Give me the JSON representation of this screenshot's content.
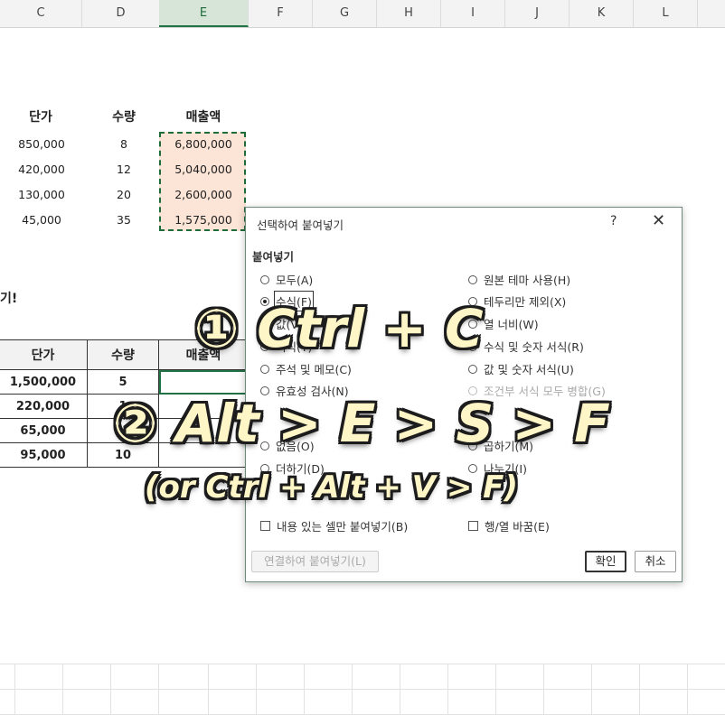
{
  "columns": [
    "C",
    "D",
    "E",
    "F",
    "G",
    "H",
    "I",
    "J",
    "K",
    "L"
  ],
  "table1": {
    "headers": [
      "단가",
      "수량",
      "매출액"
    ],
    "rows": [
      [
        "850,000",
        "8",
        "6,800,000"
      ],
      [
        "420,000",
        "12",
        "5,040,000"
      ],
      [
        "130,000",
        "20",
        "2,600,000"
      ],
      [
        "45,000",
        "35",
        "1,575,000"
      ]
    ]
  },
  "side_text": "기!",
  "table2": {
    "headers": [
      "단가",
      "수량",
      "매출액"
    ],
    "rows": [
      [
        "1,500,000",
        "5",
        ""
      ],
      [
        "220,000",
        "1",
        ""
      ],
      [
        "65,000",
        "",
        ""
      ],
      [
        "95,000",
        "10",
        ""
      ]
    ]
  },
  "dialog": {
    "title": "선택하여 붙여넣기",
    "help": "?",
    "close": "✕",
    "paste_group": "붙여넣기",
    "paste_left": [
      "모두(A)",
      "수식(F)",
      "값(V)",
      "서식(T)",
      "주석 및 메모(C)",
      "유효성 검사(N)"
    ],
    "paste_right": [
      "원본 테마 사용(H)",
      "테두리만 제외(X)",
      "열 너비(W)",
      "수식 및 숫자 서식(R)",
      "값 및 숫자 서식(U)",
      "조건부 서식 모두 병합(G)"
    ],
    "op_left": [
      "없음(O)",
      "더하기(D)"
    ],
    "op_right": [
      "곱하기(M)",
      "나누기(I)"
    ],
    "skip_blanks": "내용 있는 셀만 붙여넣기(B)",
    "transpose": "행/열 바꿈(E)",
    "paste_link": "연결하여 붙여넣기(L)",
    "ok": "확인",
    "cancel": "취소"
  },
  "overlay": {
    "line1": "① Ctrl + C",
    "line2": "② Alt > E > S > F",
    "line3": "(or Ctrl + Alt + V > F)"
  }
}
